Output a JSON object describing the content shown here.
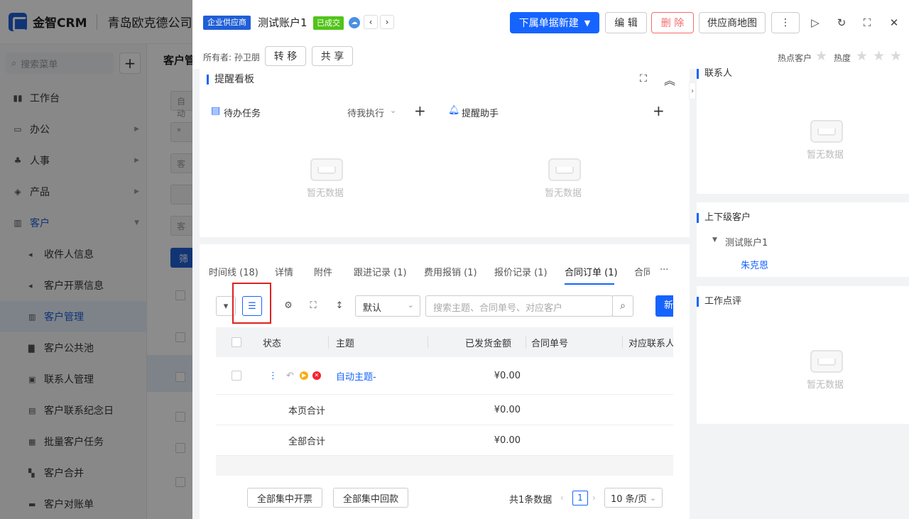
{
  "sidebar": {
    "brand": "金智CRM",
    "company": "青岛欧克德公司",
    "search_placeholder": "搜索菜单",
    "menu": [
      {
        "label": "工作台",
        "icon": "▮▮"
      },
      {
        "label": "办公",
        "icon": "▭"
      },
      {
        "label": "人事",
        "icon": "♣"
      },
      {
        "label": "产品",
        "icon": "◈"
      },
      {
        "label": "客户",
        "icon": "▥"
      }
    ],
    "submenu": [
      {
        "label": "收件人信息",
        "icon": "◂"
      },
      {
        "label": "客户开票信息",
        "icon": "◂"
      },
      {
        "label": "客户管理",
        "icon": "▥"
      },
      {
        "label": "客户公共池",
        "icon": "▇"
      },
      {
        "label": "联系人管理",
        "icon": "▣"
      },
      {
        "label": "客户联系纪念日",
        "icon": "▤"
      },
      {
        "label": "批量客户任务",
        "icon": "▦"
      },
      {
        "label": "客户合并",
        "icon": "▚"
      },
      {
        "label": "客户对账单",
        "icon": "▬"
      }
    ]
  },
  "background": {
    "title": "客户管",
    "block1": "自动",
    "block2": "*",
    "block3": "客",
    "block5": "客",
    "filter_btn": "筛"
  },
  "header": {
    "supplier_tag": "企业供应商",
    "account_name": "测试账户1",
    "status_tag": "已成交",
    "btn_new_sub": "下属单据新建",
    "btn_edit": "编 辑",
    "btn_delete": "删 除",
    "btn_map": "供应商地图",
    "btn_more": "⋮",
    "owner_label": "所有者: 孙卫朋",
    "btn_transfer": "转 移",
    "btn_share": "共 享",
    "hot_customer": "热点客户",
    "heat": "热度"
  },
  "reminder": {
    "title": "提醒看板",
    "todo": "待办任务",
    "todo_filter": "待我执行",
    "assistant": "提醒助手",
    "empty": "暂无数据"
  },
  "tabs": [
    {
      "label": "时间线 (18)"
    },
    {
      "label": "详情"
    },
    {
      "label": "附件"
    },
    {
      "label": "跟进记录 (1)"
    },
    {
      "label": "费用报销 (1)"
    },
    {
      "label": "报价记录 (1)"
    },
    {
      "label": "合同订单 (1)"
    },
    {
      "label": "合同"
    }
  ],
  "tabs_more": "···",
  "toolbar": {
    "view_select": "默认",
    "search_placeholder": "搜索主题、合同单号、对应客户",
    "new_btn": "新"
  },
  "table": {
    "headers": [
      "状态",
      "主题",
      "已发货金额",
      "合同单号",
      "对应联系人"
    ],
    "rows": [
      {
        "subject": "自动主题-",
        "amount": "¥0.00"
      }
    ],
    "page_total_label": "本页合计",
    "page_total": "¥0.00",
    "all_total_label": "全部合计",
    "all_total": "¥0.00"
  },
  "footer": {
    "btn_invoice": "全部集中开票",
    "btn_payment": "全部集中回款",
    "total_text": "共1条数据",
    "page": "1",
    "page_size": "10 条/页"
  },
  "right": {
    "contacts_title": "联系人",
    "contacts_empty": "暂无数据",
    "hierarchy_title": "上下级客户",
    "parent": "测试账户1",
    "child": "朱克恩",
    "review_title": "工作点评",
    "review_empty": "暂无数据"
  }
}
